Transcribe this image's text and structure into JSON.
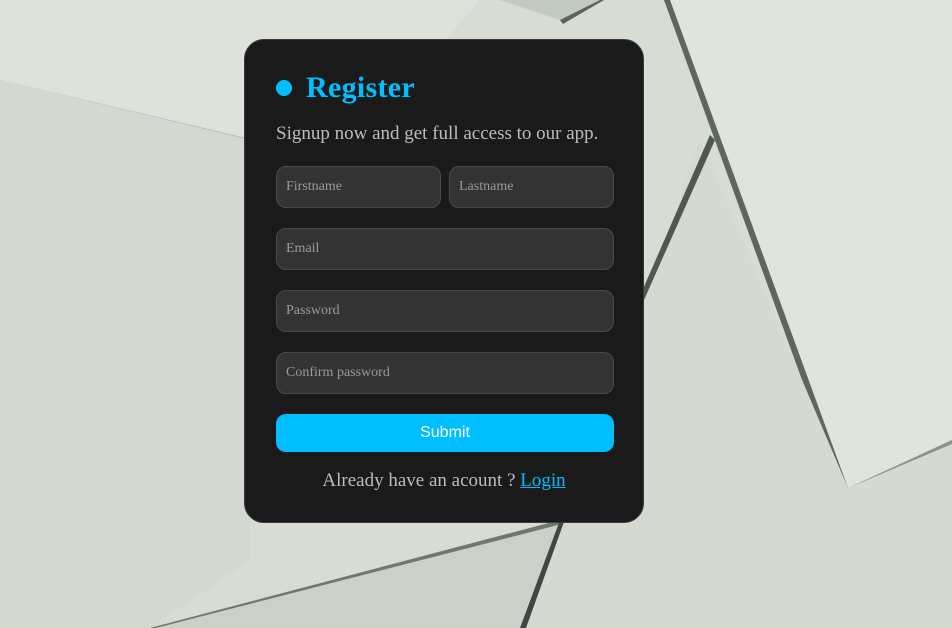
{
  "background": {
    "description_icon": "paper-sheets-background"
  },
  "form": {
    "title": "Register",
    "subtitle": "Signup now and get full access to our app.",
    "fields": {
      "firstname": {
        "value": "",
        "placeholder": "Firstname"
      },
      "lastname": {
        "value": "",
        "placeholder": "Lastname"
      },
      "email": {
        "value": "",
        "placeholder": "Email"
      },
      "password": {
        "value": "",
        "placeholder": "Password"
      },
      "confirm_password": {
        "value": "",
        "placeholder": "Confirm password"
      }
    },
    "submit_label": "Submit",
    "footer_text": "Already have an acount ? ",
    "login_link": "Login"
  },
  "colors": {
    "accent": "#00bfff",
    "card": "#1a1a1a",
    "field": "#333333",
    "background": "#d9ded7"
  }
}
